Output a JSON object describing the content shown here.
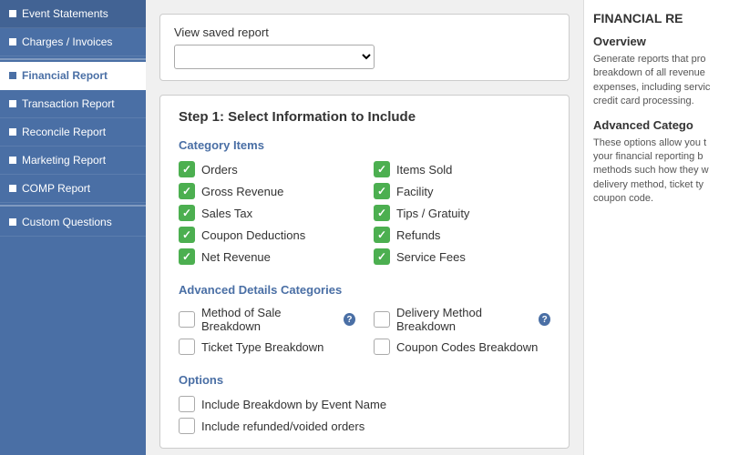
{
  "sidebar": {
    "items": [
      {
        "id": "event-statements",
        "label": "Event Statements",
        "active": false
      },
      {
        "id": "charges-invoices",
        "label": "Charges / Invoices",
        "active": false
      },
      {
        "id": "financial-report",
        "label": "Financial Report",
        "active": true
      },
      {
        "id": "transaction-report",
        "label": "Transaction Report",
        "active": false
      },
      {
        "id": "reconcile-report",
        "label": "Reconcile Report",
        "active": false
      },
      {
        "id": "marketing-report",
        "label": "Marketing Report",
        "active": false
      },
      {
        "id": "comp-report",
        "label": "COMP Report",
        "active": false
      },
      {
        "id": "custom-questions",
        "label": "Custom Questions",
        "active": false
      }
    ]
  },
  "saved_report": {
    "label": "View saved report",
    "placeholder": ""
  },
  "step": {
    "title": "Step 1: Select Information to Include"
  },
  "category_items": {
    "section_title": "Category Items",
    "items_col1": [
      {
        "id": "orders",
        "label": "Orders",
        "checked": true
      },
      {
        "id": "gross-revenue",
        "label": "Gross Revenue",
        "checked": true
      },
      {
        "id": "sales-tax",
        "label": "Sales Tax",
        "checked": true
      },
      {
        "id": "coupon-deductions",
        "label": "Coupon Deductions",
        "checked": true
      },
      {
        "id": "net-revenue",
        "label": "Net Revenue",
        "checked": true
      }
    ],
    "items_col2": [
      {
        "id": "items-sold",
        "label": "Items Sold",
        "checked": true
      },
      {
        "id": "facility",
        "label": "Facility",
        "checked": true
      },
      {
        "id": "tips-gratuity",
        "label": "Tips / Gratuity",
        "checked": true
      },
      {
        "id": "refunds",
        "label": "Refunds",
        "checked": true
      },
      {
        "id": "service-fees",
        "label": "Service Fees",
        "checked": true
      }
    ]
  },
  "advanced_details": {
    "section_title": "Advanced Details Categories",
    "items_col1": [
      {
        "id": "method-of-sale",
        "label": "Method of Sale Breakdown",
        "checked": false,
        "info": true
      },
      {
        "id": "ticket-type",
        "label": "Ticket Type Breakdown",
        "checked": false,
        "info": false
      }
    ],
    "items_col2": [
      {
        "id": "delivery-method",
        "label": "Delivery Method Breakdown",
        "checked": false,
        "info": true
      },
      {
        "id": "coupon-codes",
        "label": "Coupon Codes Breakdown",
        "checked": false,
        "info": false
      }
    ]
  },
  "options": {
    "section_title": "Options",
    "items": [
      {
        "id": "breakdown-by-event",
        "label": "Include Breakdown by Event Name",
        "checked": false
      },
      {
        "id": "refunded-voided",
        "label": "Include refunded/voided orders",
        "checked": false
      }
    ]
  },
  "right_panel": {
    "title": "FINANCIAL RE",
    "overview_title": "Overview",
    "overview_text": "Generate reports that pro breakdown of all revenue expenses, including servic credit card processing.",
    "advanced_title": "Advanced Catego",
    "advanced_text": "These options allow you t your financial reporting b methods such how they w delivery method, ticket ty coupon code."
  }
}
